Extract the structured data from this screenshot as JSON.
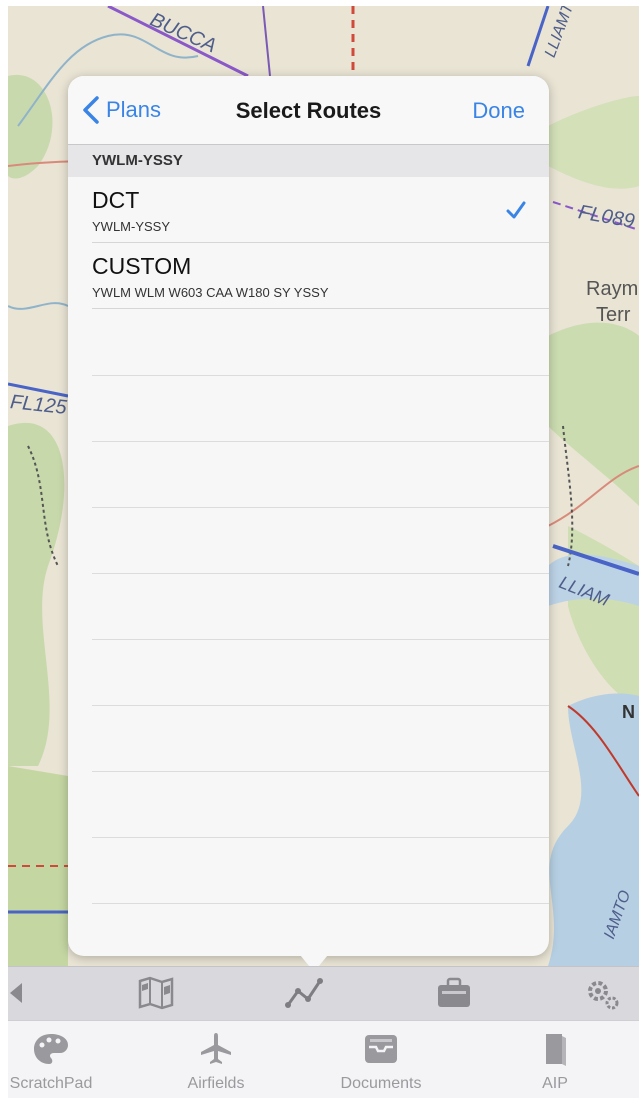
{
  "map": {
    "labels": {
      "bucca": "BUCCA",
      "fl089": "FL089",
      "fl125": "FL125",
      "raym": "Raym",
      "terr": "Terr",
      "williamtown_top": "LLIAMTO",
      "williamtown_mid": "LLIAM",
      "n": "N",
      "william_bottom": "IAMTO"
    },
    "colors": {
      "land": "#e9e4d4",
      "green": "#c4d6a8",
      "water": "#b6cfe3",
      "route_blue": "#4a63c7",
      "route_purple": "#8a58c9"
    }
  },
  "popover": {
    "back_label": "Plans",
    "title": "Select Routes",
    "done_label": "Done",
    "section_header": "YWLM-YSSY",
    "routes": [
      {
        "name": "DCT",
        "detail": "YWLM-YSSY",
        "selected": true
      },
      {
        "name": "CUSTOM",
        "detail": "YWLM WLM W603 CAA W180 SY YSSY",
        "selected": false
      }
    ],
    "accent": "#3a84e6"
  },
  "toolbar": {
    "icons": [
      "arrow-left-icon",
      "map-icon",
      "route-icon",
      "briefcase-icon",
      "settings-icon"
    ]
  },
  "tabbar": {
    "tabs": [
      {
        "label": "ScratchPad",
        "icon": "palette-icon"
      },
      {
        "label": "Airfields",
        "icon": "airplane-icon"
      },
      {
        "label": "Documents",
        "icon": "inbox-icon"
      },
      {
        "label": "AIP",
        "icon": "book-icon"
      }
    ]
  }
}
